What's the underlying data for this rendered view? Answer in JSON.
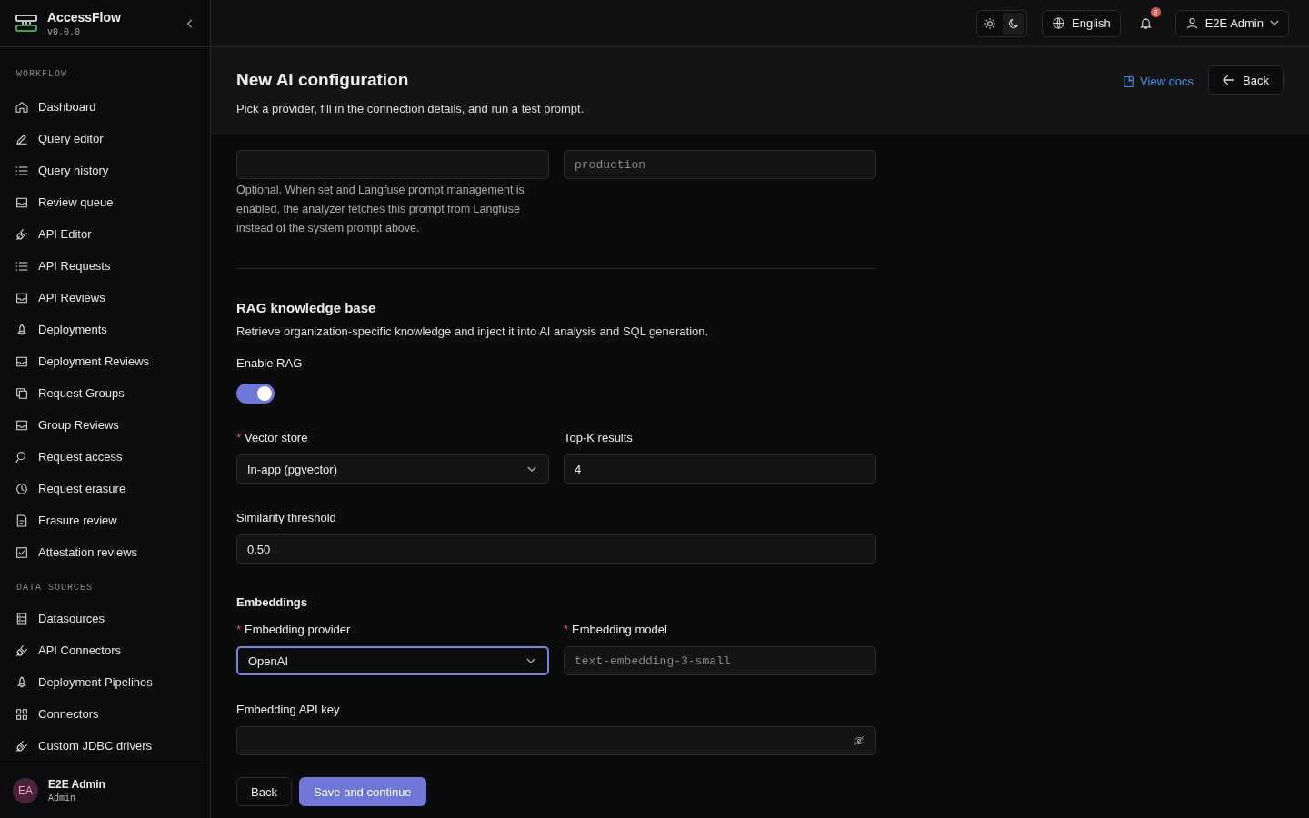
{
  "app": {
    "name": "AccessFlow",
    "version": "v0.0.0"
  },
  "sidebar": {
    "sections": [
      {
        "title": "WORKFLOW",
        "items": [
          {
            "label": "Dashboard",
            "selected": false
          },
          {
            "label": "Query editor",
            "selected": false
          },
          {
            "label": "Query history",
            "selected": false
          },
          {
            "label": "Review queue",
            "selected": false
          },
          {
            "label": "API Editor",
            "selected": false
          },
          {
            "label": "API Requests",
            "selected": false
          },
          {
            "label": "API Reviews",
            "selected": false
          },
          {
            "label": "Deployments",
            "selected": false
          },
          {
            "label": "Deployment Reviews",
            "selected": false
          },
          {
            "label": "Request Groups",
            "selected": false
          },
          {
            "label": "Group Reviews",
            "selected": false
          },
          {
            "label": "Request access",
            "selected": false
          },
          {
            "label": "Request erasure",
            "selected": false
          },
          {
            "label": "Erasure review",
            "selected": false
          },
          {
            "label": "Attestation reviews",
            "selected": false
          }
        ]
      },
      {
        "title": "DATA SOURCES",
        "items": [
          {
            "label": "Datasources",
            "selected": false
          },
          {
            "label": "API Connectors",
            "selected": false
          },
          {
            "label": "Deployment Pipelines",
            "selected": false
          },
          {
            "label": "Connectors",
            "selected": false
          },
          {
            "label": "Custom JDBC drivers",
            "selected": false
          }
        ]
      }
    ],
    "user": {
      "initials": "EA",
      "name": "E2E Admin",
      "role": "Admin"
    }
  },
  "topbar": {
    "theme": [
      {
        "kind": "light",
        "selected": false
      },
      {
        "kind": "dark",
        "selected": true
      }
    ],
    "language": "English",
    "notifications": "8",
    "user": "E2E Admin"
  },
  "page": {
    "title": "New AI configuration",
    "subtitle": "Pick a provider, fill in the connection details, and run a test prompt.",
    "docs_link": "View docs",
    "back": "Back"
  },
  "langfuse": {
    "label_placeholder": "production",
    "help": "Optional. When set and Langfuse prompt management is enabled, the analyzer fetches this prompt from Langfuse instead of the system prompt above."
  },
  "rag": {
    "title": "RAG knowledge base",
    "description": "Retrieve organization-specific knowledge and inject it into AI analysis and SQL generation.",
    "enable_label": "Enable RAG",
    "enabled": true,
    "vector_store": {
      "label": "Vector store",
      "required_mark": "*",
      "value": "In-app (pgvector)"
    },
    "top_k": {
      "label": "Top-K results",
      "value": "4"
    },
    "similarity": {
      "label": "Similarity threshold",
      "value": "0.50"
    },
    "embeddings_title": "Embeddings",
    "provider": {
      "label": "Embedding provider",
      "required_mark": "*",
      "value": "OpenAI",
      "focused": true
    },
    "model": {
      "label": "Embedding model",
      "required_mark": "*",
      "placeholder": "text-embedding-3-small"
    },
    "api_key": {
      "label": "Embedding API key"
    }
  },
  "actions": {
    "back": "Back",
    "save": "Save and continue"
  }
}
